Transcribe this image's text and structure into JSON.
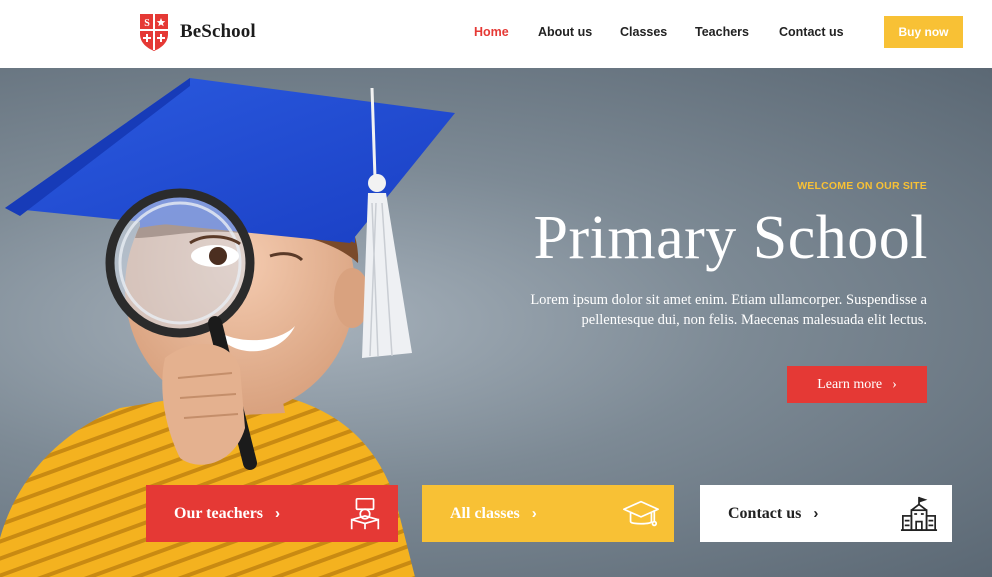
{
  "brand": {
    "name": "BeSchool",
    "shield_letter_1": "S",
    "shield_letter_2": "+",
    "colors": {
      "red": "#e53935",
      "yellow": "#f8c135",
      "dark": "#1c1c1c"
    }
  },
  "nav": {
    "items": [
      {
        "label": "Home",
        "active": true
      },
      {
        "label": "About us",
        "active": false
      },
      {
        "label": "Classes",
        "active": false
      },
      {
        "label": "Teachers",
        "active": false
      },
      {
        "label": "Contact us",
        "active": false
      }
    ],
    "buy_label": "Buy now"
  },
  "hero": {
    "eyebrow": "WELCOME ON OUR SITE",
    "title": "Primary School",
    "description": "Lorem ipsum dolor sit amet enim. Etiam ullamcorper. Suspendisse a pellentesque dui, non felis. Maecenas malesuada elit lectus.",
    "cta_label": "Learn more",
    "cta_icon": "chevron-right-icon"
  },
  "cards": [
    {
      "label": "Our teachers",
      "icon": "teacher-desk-icon"
    },
    {
      "label": "All classes",
      "icon": "graduation-cap-icon"
    },
    {
      "label": "Contact us",
      "icon": "school-building-icon"
    }
  ]
}
